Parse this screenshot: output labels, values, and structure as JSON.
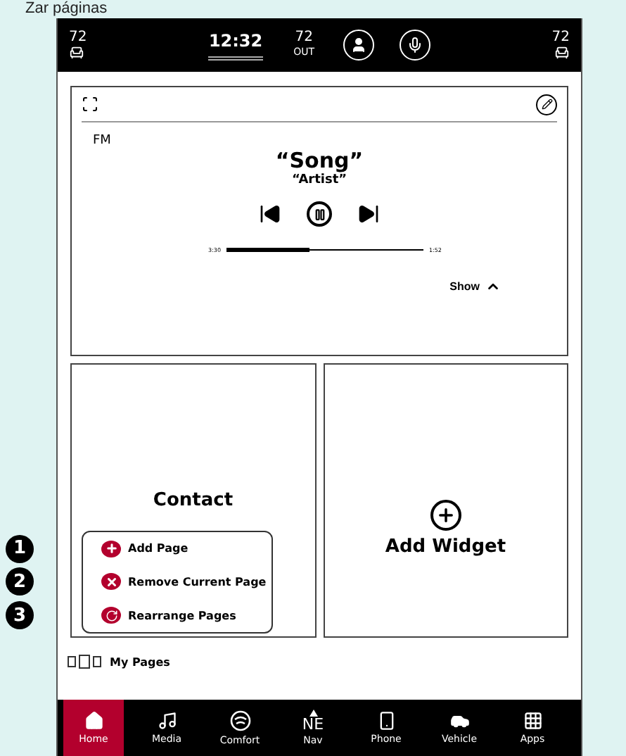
{
  "caption": "Zar páginas",
  "status_bar": {
    "left_temp": "72",
    "time": "12:32",
    "out_temp": "72",
    "out_label": "OUT",
    "right_temp": "72"
  },
  "media": {
    "source": "FM",
    "title": "“Song”",
    "artist": "“Artist”",
    "elapsed": "3:30",
    "remaining": "1:52",
    "level": 0.42,
    "show_label": "Show"
  },
  "widgets": [
    {
      "kind": "contact",
      "label": "Contact"
    },
    {
      "kind": "add",
      "label": "Add Widget"
    }
  ],
  "callouts": [
    {
      "number": "1",
      "kind": "add",
      "label": "Add Page"
    },
    {
      "number": "2",
      "kind": "remove",
      "label": "Remove Current Page"
    },
    {
      "number": "3",
      "kind": "rearrange",
      "label": "Rearrange Pages"
    }
  ],
  "pages": {
    "label": "My Pages",
    "indicators": [
      {
        "selected": false
      },
      {
        "selected": true
      },
      {
        "selected": false
      }
    ]
  },
  "nav": [
    {
      "kind": "home",
      "label": "Home",
      "selected": true
    },
    {
      "kind": "media",
      "label": "Media",
      "selected": false
    },
    {
      "kind": "comfort",
      "label": "Comfort",
      "selected": false
    },
    {
      "kind": "nav",
      "heading": "NE",
      "label": "Nav",
      "selected": false
    },
    {
      "kind": "phone",
      "label": "Phone",
      "selected": false
    },
    {
      "kind": "vehicle",
      "label": "Vehicle",
      "selected": false
    },
    {
      "kind": "apps",
      "label": "Apps",
      "selected": false
    }
  ]
}
